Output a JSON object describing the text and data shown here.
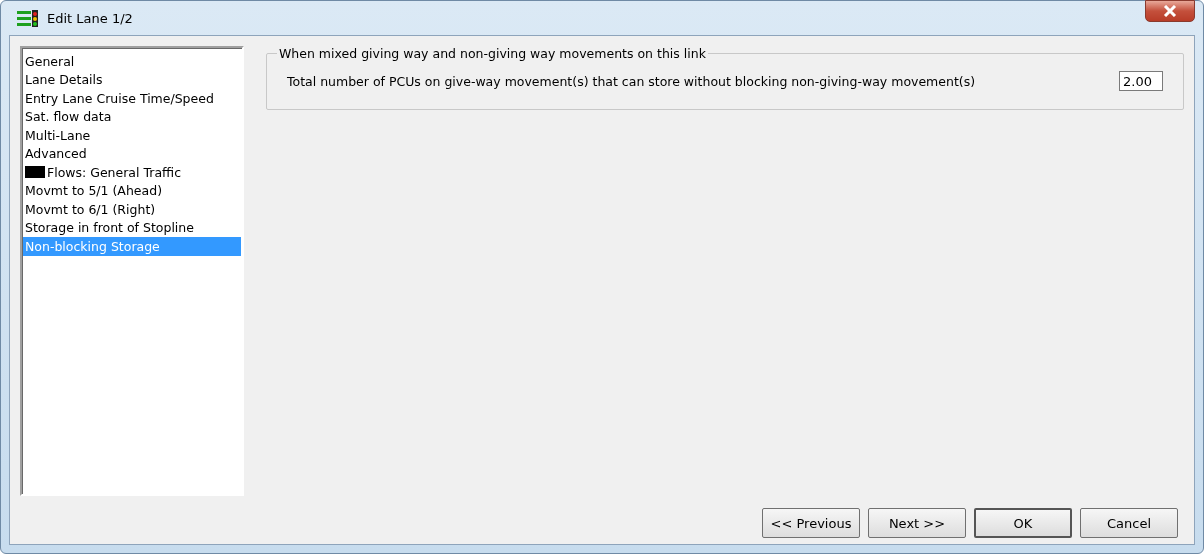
{
  "window": {
    "title": "Edit Lane 1/2"
  },
  "sidebar": {
    "items": [
      {
        "label": "General",
        "selected": false
      },
      {
        "label": "Lane Details",
        "selected": false
      },
      {
        "label": "Entry Lane Cruise Time/Speed",
        "selected": false
      },
      {
        "label": "Sat. flow data",
        "selected": false
      },
      {
        "label": "Multi-Lane",
        "selected": false
      },
      {
        "label": "Advanced",
        "selected": false
      },
      {
        "label": "Flows: General Traffic",
        "selected": false,
        "color": "#000000"
      },
      {
        "label": "Movmt to 5/1 (Ahead)",
        "selected": false
      },
      {
        "label": "Movmt to 6/1 (Right)",
        "selected": false
      },
      {
        "label": "Storage in front of Stopline",
        "selected": false
      },
      {
        "label": "Non-blocking Storage",
        "selected": true
      }
    ]
  },
  "group": {
    "title": "When mixed giving way and non-giving way movements on this link",
    "field": {
      "label": "Total number of PCUs on give-way movement(s) that can store without blocking non-giving-way movement(s)",
      "value": "2.00"
    }
  },
  "buttons": [
    {
      "label": "<< Previous",
      "default": false
    },
    {
      "label": "Next >>",
      "default": false
    },
    {
      "label": "OK",
      "default": true
    },
    {
      "label": "Cancel",
      "default": false
    }
  ]
}
